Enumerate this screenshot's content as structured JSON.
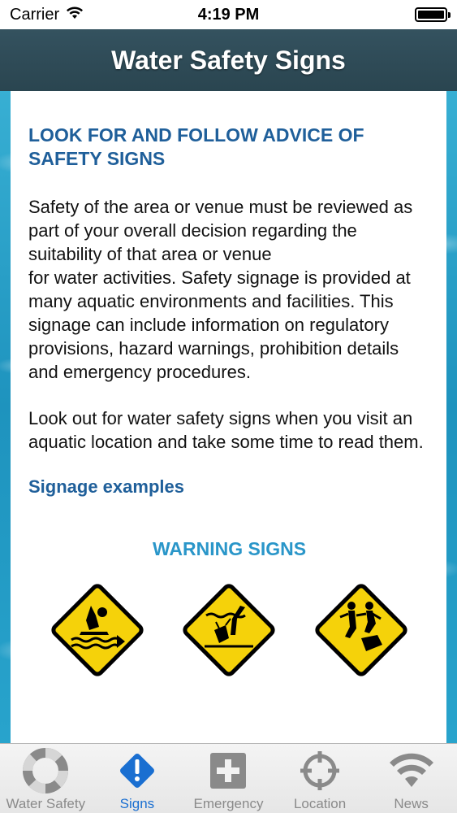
{
  "status_bar": {
    "carrier": "Carrier",
    "time": "4:19 PM"
  },
  "nav": {
    "title": "Water Safety Signs"
  },
  "content": {
    "heading_line1": "LOOK FOR AND FOLLOW ADVICE OF",
    "heading_line2": "SAFETY SIGNS",
    "paragraph1": "Safety of the area or venue must be reviewed as part of your overall decision regarding the suitability of that area or venue",
    "paragraph1b": "for water activities. Safety signage is provided at many aquatic environments and facilities. This signage can include information on regulatory provisions, hazard warnings, prohibition details and emergency procedures.",
    "paragraph2": "Look out for water safety signs when you visit an aquatic location and take some time to read them.",
    "link": "Signage examples",
    "section_title": "WARNING SIGNS"
  },
  "signs": [
    {
      "icon": "swimmer-warning-sign-icon"
    },
    {
      "icon": "submerged-object-warning-sign-icon"
    },
    {
      "icon": "slippery-rocks-warning-sign-icon"
    }
  ],
  "tabs": [
    {
      "label": "Water Safety",
      "icon": "lifebuoy-icon",
      "active": false
    },
    {
      "label": "Signs",
      "icon": "warning-diamond-icon",
      "active": true
    },
    {
      "label": "Emergency",
      "icon": "first-aid-cross-icon",
      "active": false
    },
    {
      "label": "Location",
      "icon": "crosshair-icon",
      "active": false
    },
    {
      "label": "News",
      "icon": "wifi-broadcast-icon",
      "active": false
    }
  ],
  "colors": {
    "accent": "#1a6fd1",
    "heading": "#1f5f9a",
    "section_title": "#2a96c9",
    "sign_yellow": "#f5d20a",
    "nav_bar": "#2e4a55"
  }
}
